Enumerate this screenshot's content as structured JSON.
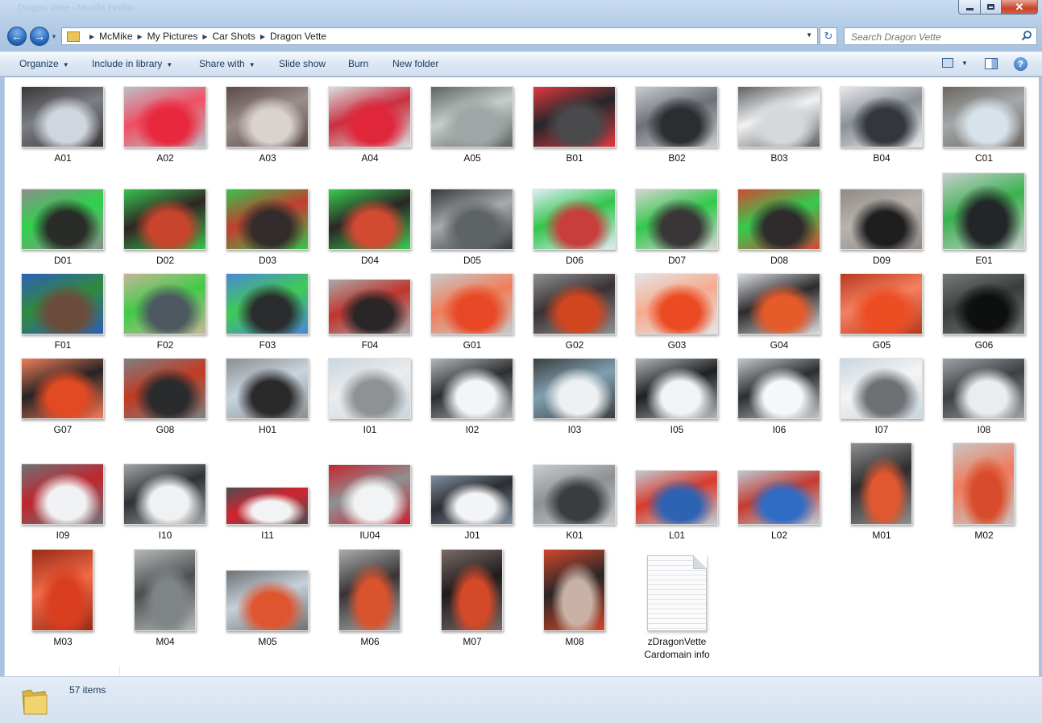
{
  "window": {
    "title_ghost": "Dragon Vette - Mozilla Firefox",
    "minimize_icon": "minimize-icon",
    "maximize_icon": "maximize-icon",
    "close_label": "✕"
  },
  "address": {
    "back_icon": "back-arrow-icon",
    "forward_icon": "forward-arrow-icon",
    "crumbs": [
      "McMike",
      "My Pictures",
      "Car Shots",
      "Dragon Vette"
    ],
    "refresh_icon": "refresh-icon"
  },
  "search": {
    "placeholder": "Search Dragon Vette"
  },
  "toolbar": {
    "organize": "Organize",
    "include_in_library": "Include in library",
    "share_with": "Share with",
    "slide_show": "Slide show",
    "burn": "Burn",
    "new_folder": "New folder"
  },
  "files": [
    {
      "name": "A01",
      "colors": [
        "#cfd6dd",
        "#7b7f86",
        "#3a3537"
      ]
    },
    {
      "name": "A02",
      "colors": [
        "#e8283d",
        "#f04f63",
        "#b9c0c8"
      ]
    },
    {
      "name": "A03",
      "colors": [
        "#d9d2cf",
        "#9a8e8b",
        "#5a4a48"
      ]
    },
    {
      "name": "A04",
      "colors": [
        "#e0263b",
        "#c9303e",
        "#d9dde0"
      ]
    },
    {
      "name": "A05",
      "colors": [
        "#9fa7a6",
        "#c7cdcb",
        "#5d6463"
      ]
    },
    {
      "name": "B01",
      "colors": [
        "#4a4a4c",
        "#25262a",
        "#e1383f"
      ]
    },
    {
      "name": "B02",
      "colors": [
        "#2b2d31",
        "#6c7177",
        "#c8ccd0"
      ]
    },
    {
      "name": "B03",
      "colors": [
        "#d6d8db",
        "#f1f2f3",
        "#5f6265"
      ]
    },
    {
      "name": "B04",
      "colors": [
        "#33373c",
        "#8a9097",
        "#e7e9eb"
      ]
    },
    {
      "name": "C01",
      "colors": [
        "#d8e2ea",
        "#a4a8aa",
        "#6c6660"
      ]
    },
    {
      "name": "D01",
      "colors": [
        "#2a2c2a",
        "#2ed24a",
        "#8b8f8c"
      ]
    },
    {
      "name": "D02",
      "colors": [
        "#c9442d",
        "#2f2524",
        "#36c34e"
      ]
    },
    {
      "name": "D03",
      "colors": [
        "#322c2a",
        "#c33d30",
        "#35c44b"
      ]
    },
    {
      "name": "D04",
      "colors": [
        "#d34a33",
        "#2b2625",
        "#37cc4f"
      ]
    },
    {
      "name": "D05",
      "colors": [
        "#5e6366",
        "#a7aaac",
        "#373a3c"
      ]
    },
    {
      "name": "D06",
      "colors": [
        "#c83e3c",
        "#34c54c",
        "#deeef7"
      ]
    },
    {
      "name": "D07",
      "colors": [
        "#3a3537",
        "#33c94c",
        "#d8d4d3"
      ]
    },
    {
      "name": "D08",
      "colors": [
        "#2f2b2c",
        "#34cb4d",
        "#d04934"
      ]
    },
    {
      "name": "D09",
      "colors": [
        "#1f1e1f",
        "#b9b3ae",
        "#8e8985"
      ]
    },
    {
      "name": "E01",
      "colors": [
        "#232628",
        "#3ab24e",
        "#c9cdcf"
      ]
    },
    {
      "name": "F01",
      "colors": [
        "#6b4c3c",
        "#2f8a3d",
        "#2e5fb7"
      ]
    },
    {
      "name": "F02",
      "colors": [
        "#4d5860",
        "#42cb47",
        "#c5b697"
      ]
    },
    {
      "name": "F03",
      "colors": [
        "#2a2c2e",
        "#3fcb55",
        "#4a88d6"
      ]
    },
    {
      "name": "F04",
      "colors": [
        "#2a2526",
        "#c0352d",
        "#a9a9a9"
      ]
    },
    {
      "name": "G01",
      "colors": [
        "#e84825",
        "#f07e5a",
        "#c7c9cb"
      ]
    },
    {
      "name": "G02",
      "colors": [
        "#d2461f",
        "#3a3133",
        "#8d8f92"
      ]
    },
    {
      "name": "G03",
      "colors": [
        "#ec4a22",
        "#f6ab8d",
        "#e3e4e6"
      ]
    },
    {
      "name": "G04",
      "colors": [
        "#e65b2a",
        "#2e2a2d",
        "#d9dde0"
      ]
    },
    {
      "name": "G05",
      "colors": [
        "#ec4d23",
        "#f4805e",
        "#b83a1f"
      ]
    },
    {
      "name": "G06",
      "colors": [
        "#0e0f0f",
        "#3a3d3c",
        "#767a79"
      ]
    },
    {
      "name": "G07",
      "colors": [
        "#e24a23",
        "#262425",
        "#f27b58"
      ]
    },
    {
      "name": "G08",
      "colors": [
        "#2a2b2c",
        "#c23a22",
        "#7d8083"
      ]
    },
    {
      "name": "H01",
      "colors": [
        "#2a2a2b",
        "#c8d5df",
        "#8b8e8f"
      ]
    },
    {
      "name": "I01",
      "colors": [
        "#8e9293",
        "#ebedef",
        "#c9d6df"
      ]
    },
    {
      "name": "I02",
      "colors": [
        "#f4f5f6",
        "#2c2e30",
        "#b3b7ba"
      ]
    },
    {
      "name": "I03",
      "colors": [
        "#eef0f1",
        "#7f9fb0",
        "#3b3e40"
      ]
    },
    {
      "name": "I05",
      "colors": [
        "#f2f3f4",
        "#1d1f21",
        "#b2b6b9"
      ]
    },
    {
      "name": "I06",
      "colors": [
        "#f6f7f8",
        "#2c2f32",
        "#c3c7ca"
      ]
    },
    {
      "name": "I07",
      "colors": [
        "#6e7174",
        "#f4f4f5",
        "#c7d6e0"
      ]
    },
    {
      "name": "I08",
      "colors": [
        "#ebeced",
        "#3c4043",
        "#9ea2a5"
      ]
    },
    {
      "name": "I09",
      "colors": [
        "#f1f2f3",
        "#c0262e",
        "#6d7276"
      ]
    },
    {
      "name": "I10",
      "colors": [
        "#f0f1f2",
        "#2e3236",
        "#a1a5a8"
      ]
    },
    {
      "name": "I11",
      "colors": [
        "#f2f3f4",
        "#d2242e",
        "#4b4e51"
      ]
    },
    {
      "name": "IU04",
      "colors": [
        "#f2f3f4",
        "#8e9193",
        "#c6242f"
      ]
    },
    {
      "name": "J01",
      "colors": [
        "#f3f4f5",
        "#2b2e32",
        "#7f8fa0"
      ]
    },
    {
      "name": "K01",
      "colors": [
        "#3a3d40",
        "#8d9194",
        "#c9ccce"
      ]
    },
    {
      "name": "L01",
      "colors": [
        "#2e63b4",
        "#d83b2c",
        "#c0cbd4"
      ]
    },
    {
      "name": "L02",
      "colors": [
        "#2e6cc6",
        "#c43b30",
        "#bcc9d5"
      ]
    },
    {
      "name": "M01",
      "colors": [
        "#e0582f",
        "#2e2b2c",
        "#8d9091"
      ]
    },
    {
      "name": "M02",
      "colors": [
        "#d84c2c",
        "#f07a5c",
        "#c9c5c3"
      ]
    },
    {
      "name": "M03",
      "colors": [
        "#d93e1f",
        "#f06b48",
        "#9a2a16"
      ]
    },
    {
      "name": "M04",
      "colors": [
        "#7f8485",
        "#4b4f50",
        "#b5b9ba"
      ]
    },
    {
      "name": "M05",
      "colors": [
        "#de5530",
        "#c5d0d9",
        "#6e7274"
      ]
    },
    {
      "name": "M06",
      "colors": [
        "#d9532d",
        "#3a3334",
        "#a7abad"
      ]
    },
    {
      "name": "M07",
      "colors": [
        "#d44a28",
        "#1f1b1c",
        "#7a6a66"
      ]
    },
    {
      "name": "M08",
      "colors": [
        "#c9b2a5",
        "#2a2627",
        "#d0472b"
      ]
    },
    {
      "name": "zDragonVette Cardomain info",
      "type": "document",
      "icon": "text-document-icon"
    }
  ],
  "status": {
    "item_count": "57 items",
    "folder_icon": "folder-icon"
  }
}
